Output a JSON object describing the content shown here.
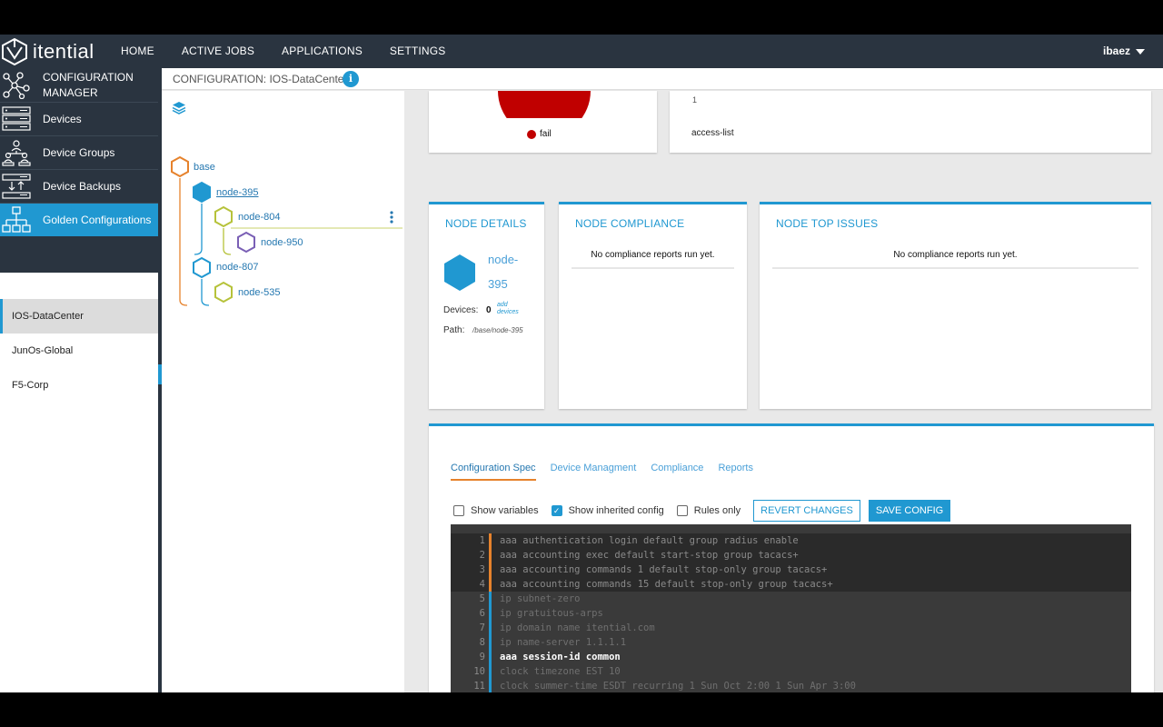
{
  "app": {
    "brand": "itential",
    "nav": [
      "HOME",
      "ACTIVE JOBS",
      "APPLICATIONS",
      "SETTINGS"
    ],
    "user": "ibaez"
  },
  "sidebar": {
    "header": "CONFIGURATION MANAGER",
    "items": [
      {
        "label": "Devices",
        "icon": "server-rack-icon"
      },
      {
        "label": "Device Groups",
        "icon": "device-groups-icon"
      },
      {
        "label": "Device Backups",
        "icon": "device-backups-icon"
      },
      {
        "label": "Golden Configurations",
        "icon": "org-tree-icon",
        "active": true
      }
    ],
    "configs": [
      "IOS-DataCenter",
      "JunOs-Global",
      "F5-Corp"
    ],
    "selected_config": "IOS-DataCenter"
  },
  "breadcrumb": {
    "text": "CONFIGURATION: IOS-DataCenter",
    "info": "i"
  },
  "tree": {
    "nodes": [
      {
        "label": "base",
        "color": "#e6822c"
      },
      {
        "label": "node-395",
        "color": "#2098d1",
        "filled": true
      },
      {
        "label": "node-804",
        "color": "#b6c23a"
      },
      {
        "label": "node-950",
        "color": "#7a5fb5"
      },
      {
        "label": "node-807",
        "color": "#2098d1"
      },
      {
        "label": "node-535",
        "color": "#b6c23a"
      }
    ]
  },
  "top_cards": {
    "status_legend": "fail",
    "status_color": "#c00000",
    "issues_line_num": "1",
    "issues_label": "access-list"
  },
  "node_details": {
    "title": "NODE DETAILS",
    "node_name_a": "node-",
    "node_name_b": "395",
    "devices_label": "Devices:",
    "devices_count": "0",
    "add_devices_a": "add",
    "add_devices_b": "devices",
    "path_label": "Path:",
    "path_value": "/base/node-395"
  },
  "node_compliance": {
    "title": "NODE COMPLIANCE",
    "message": "No compliance reports run yet."
  },
  "node_top_issues": {
    "title": "NODE TOP ISSUES",
    "message": "No compliance reports run yet."
  },
  "config_panel": {
    "tabs": [
      "Configuration Spec",
      "Device Managment",
      "Compliance",
      "Reports"
    ],
    "active_tab": "Configuration Spec",
    "show_variables": {
      "label": "Show variables",
      "checked": false
    },
    "show_inherited": {
      "label": "Show inherited config",
      "checked": true
    },
    "rules_only": {
      "label": "Rules only",
      "checked": false
    },
    "revert_label": "REVERT CHANGES",
    "save_label": "SAVE CONFIG"
  },
  "editor": {
    "lines": [
      {
        "n": "1",
        "text": "aaa authentication login default group radius enable",
        "inherited": true
      },
      {
        "n": "2",
        "text": "aaa accounting exec default start-stop group tacacs+",
        "inherited": true
      },
      {
        "n": "3",
        "text": "aaa accounting commands 1 default stop-only group tacacs+",
        "inherited": true
      },
      {
        "n": "4",
        "text": "aaa accounting commands 15 default stop-only group tacacs+",
        "inherited": true
      },
      {
        "n": "5",
        "text": "ip subnet-zero",
        "inherited": false
      },
      {
        "n": "6",
        "text": "ip gratuitous-arps",
        "inherited": false
      },
      {
        "n": "7",
        "text": "ip domain name itential.com",
        "inherited": false
      },
      {
        "n": "8",
        "text": "ip name-server 1.1.1.1",
        "inherited": false
      },
      {
        "n": "9",
        "text": "aaa session-id common",
        "inherited": false,
        "bold": true
      },
      {
        "n": "10",
        "text": "clock timezone EST 10",
        "inherited": false
      },
      {
        "n": "11",
        "text": "clock summer-time ESDT recurring 1 Sun Oct 2:00 1 Sun Apr 3:00",
        "inherited": false
      }
    ]
  }
}
